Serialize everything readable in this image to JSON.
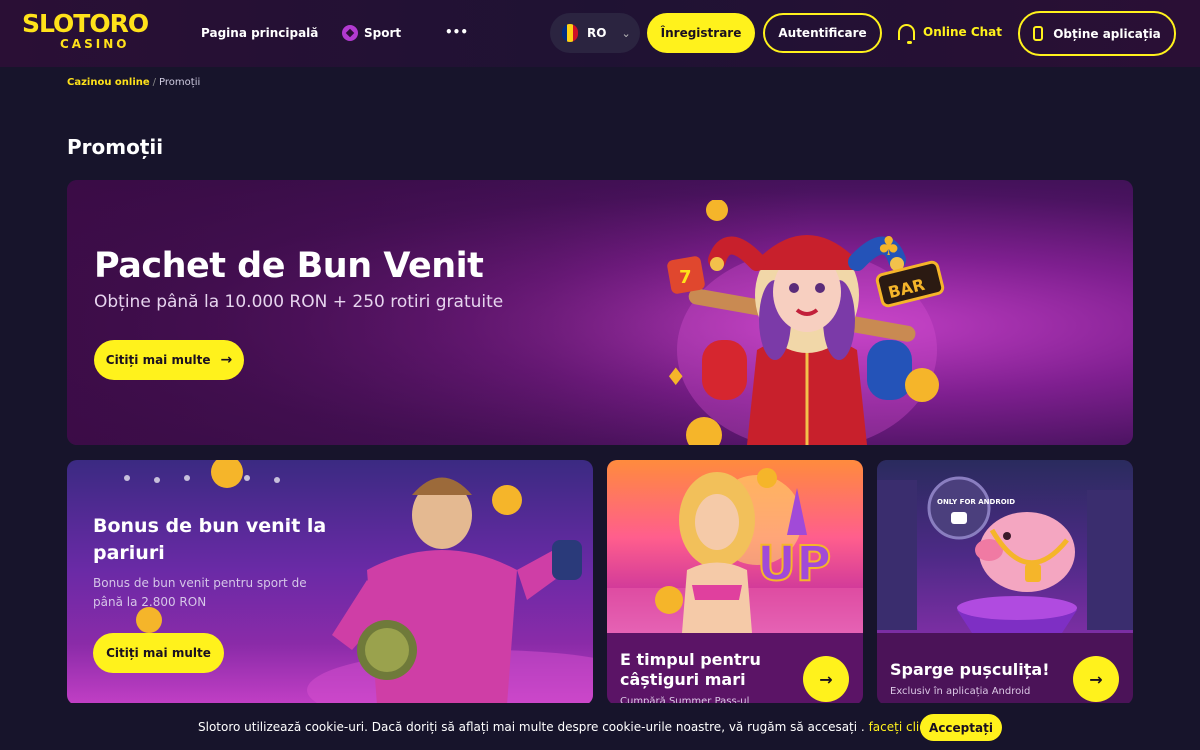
{
  "header": {
    "logo_top": "SLOTORO",
    "logo_bottom": "CASINO",
    "nav": [
      {
        "label": "Pagina principală"
      },
      {
        "label": "Sport",
        "icon": "soccer-ball-icon"
      },
      {
        "label": "•••"
      }
    ],
    "language": {
      "code": "RO",
      "flag_colors": [
        "#002b7f",
        "#fcd116",
        "#ce1126"
      ]
    },
    "register_label": "Înregistrare",
    "login_label": "Autentificare",
    "chat_label": "Online Chat",
    "app_label": "Obține aplicația"
  },
  "breadcrumb": {
    "home": "Cazinou online",
    "separator": "/",
    "current": "Promoții"
  },
  "page_title": "Promoții",
  "hero": {
    "title": "Pachet de Bun Venit",
    "subtitle": "Obține până la 10.000 RON + 250 rotiri gratuite",
    "button_label": "Citiți mai multe",
    "badge_text": "BAR",
    "dice_text": "7",
    "clover": "♣",
    "diamond": "♦"
  },
  "cards": {
    "sport": {
      "title": "Bonus de bun venit la pariuri",
      "text": "Bonus de bun venit pentru sport de până la 2.800 RON",
      "button_label": "Citiți mai multe"
    },
    "up": {
      "title": "E timpul pentru câștiguri mari",
      "text": "Cumpără Summer Pass-ul",
      "art_text": "UP"
    },
    "piggy": {
      "title": "Sparge pușculița!",
      "text": "Exclusiv în aplicația Android",
      "badge_text": "ONLY FOR ANDROID"
    }
  },
  "cookie": {
    "text": "Slotoro utilizează cookie-uri. Dacă doriți să aflați mai multe despre cookie-urile noastre, vă rugăm să accesați .",
    "link": "faceți clic aici",
    "button_label": "Acceptați"
  },
  "colors": {
    "accent": "#fff21c",
    "background": "#17142b"
  }
}
